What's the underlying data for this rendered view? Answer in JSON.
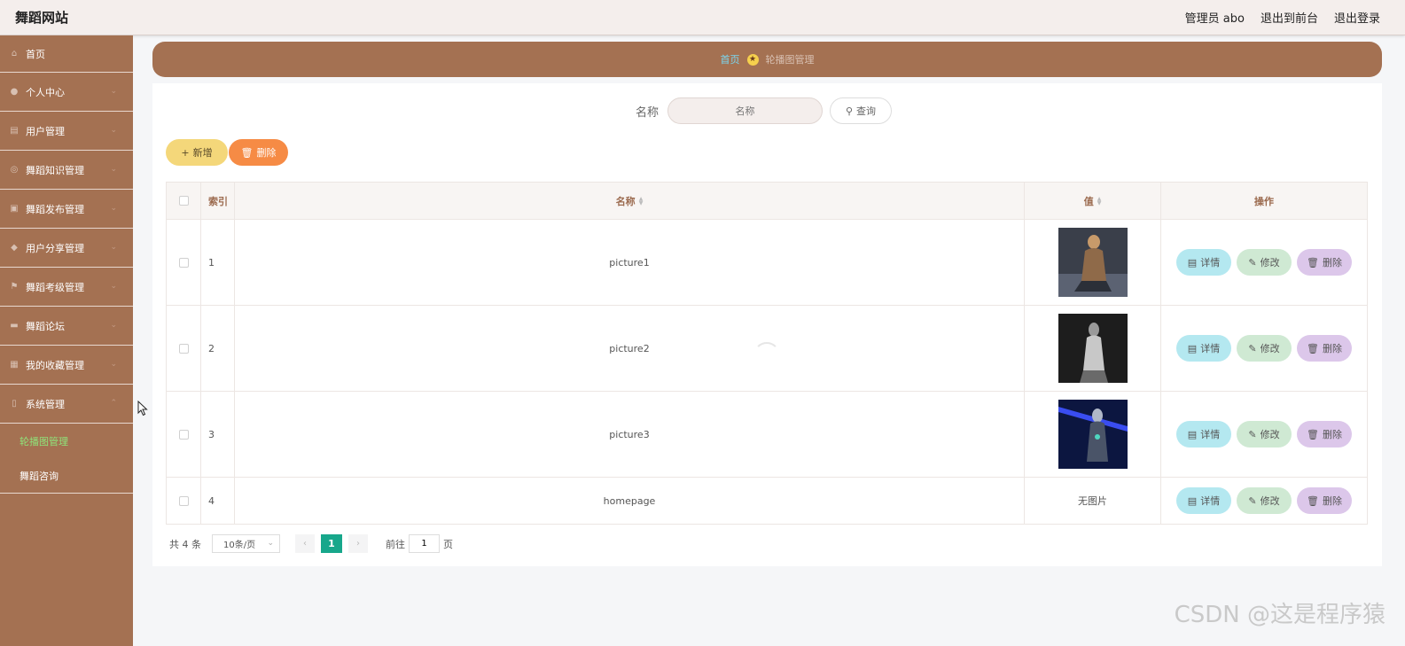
{
  "header": {
    "brand": "舞蹈网站",
    "admin_label": "管理员 abo",
    "front_link": "退出到前台",
    "logout_link": "退出登录"
  },
  "sidebar": {
    "items": [
      {
        "label": "首页",
        "icon": "home-icon"
      },
      {
        "label": "个人中心",
        "icon": "user-icon"
      },
      {
        "label": "用户管理",
        "icon": "clipboard-icon"
      },
      {
        "label": "舞蹈知识管理",
        "icon": "compass-icon"
      },
      {
        "label": "舞蹈发布管理",
        "icon": "briefcase-icon"
      },
      {
        "label": "用户分享管理",
        "icon": "location-icon"
      },
      {
        "label": "舞蹈考级管理",
        "icon": "flag-icon"
      },
      {
        "label": "舞蹈论坛",
        "icon": "chat-icon"
      },
      {
        "label": "我的收藏管理",
        "icon": "bookmark-icon"
      },
      {
        "label": "系统管理",
        "icon": "lock-icon"
      }
    ],
    "submenu": [
      {
        "label": "轮播图管理",
        "active": true
      },
      {
        "label": "舞蹈咨询",
        "active": false
      }
    ]
  },
  "breadcrumb": {
    "home": "首页",
    "current": "轮播图管理"
  },
  "search": {
    "label": "名称",
    "placeholder": "名称",
    "button": "查询"
  },
  "actions": {
    "add": "新增",
    "delete": "删除"
  },
  "table": {
    "columns": {
      "index": "索引",
      "name": "名称",
      "value": "值",
      "ops": "操作"
    },
    "rows": [
      {
        "index": "1",
        "name": "picture1",
        "image": "dancer-gold"
      },
      {
        "index": "2",
        "name": "picture2",
        "image": "dancer-mono"
      },
      {
        "index": "3",
        "name": "picture3",
        "image": "dancer-blue"
      },
      {
        "index": "4",
        "name": "homepage",
        "image": null,
        "no_image_text": "无图片"
      }
    ],
    "op_labels": {
      "detail": "详情",
      "edit": "修改",
      "delete": "删除"
    }
  },
  "pagination": {
    "total": "共 4 条",
    "page_size": "10条/页",
    "current_page": "1",
    "goto_prefix": "前往",
    "goto_value": "1",
    "goto_suffix": "页"
  },
  "watermark": "CSDN @这是程序猿",
  "colors": {
    "sidebar": "#a47152",
    "accent_green": "#17a78b",
    "add_button": "#f4d77a",
    "delete_button": "#f68b45"
  }
}
